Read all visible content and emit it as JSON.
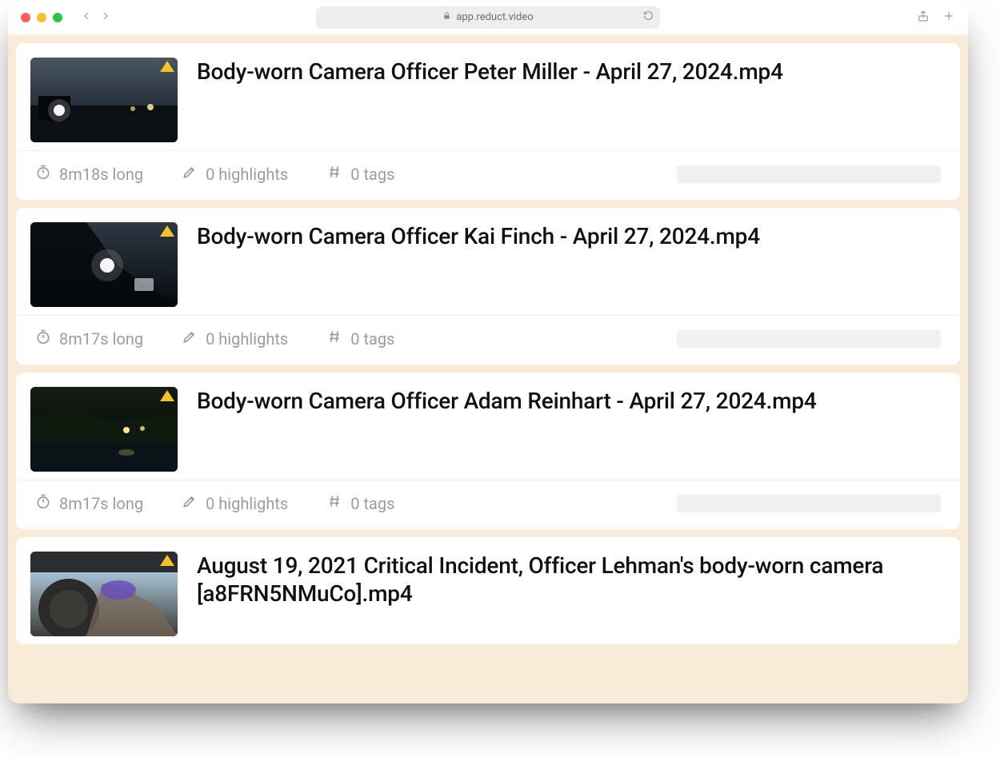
{
  "browser": {
    "url": "app.reduct.video"
  },
  "items": [
    {
      "title": "Body-worn Camera Officer Peter Miller - April 27, 2024.mp4",
      "duration": "8m18s long",
      "highlights": "0 highlights",
      "tags": "0 tags",
      "thumb": "night-street"
    },
    {
      "title": "Body-worn Camera Officer Kai Finch - April 27, 2024.mp4",
      "duration": "8m17s long",
      "highlights": "0 highlights",
      "tags": "0 tags",
      "thumb": "night-car-interior"
    },
    {
      "title": "Body-worn Camera Officer Adam Reinhart - April 27, 2024.mp4",
      "duration": "8m17s long",
      "highlights": "0 highlights",
      "tags": "0 tags",
      "thumb": "night-water"
    },
    {
      "title": "August 19, 2021 Critical Incident, Officer Lehman's body-worn camera [a8FRN5NMuCo].mp4",
      "duration": "",
      "highlights": "",
      "tags": "",
      "thumb": "day-wheel"
    }
  ]
}
